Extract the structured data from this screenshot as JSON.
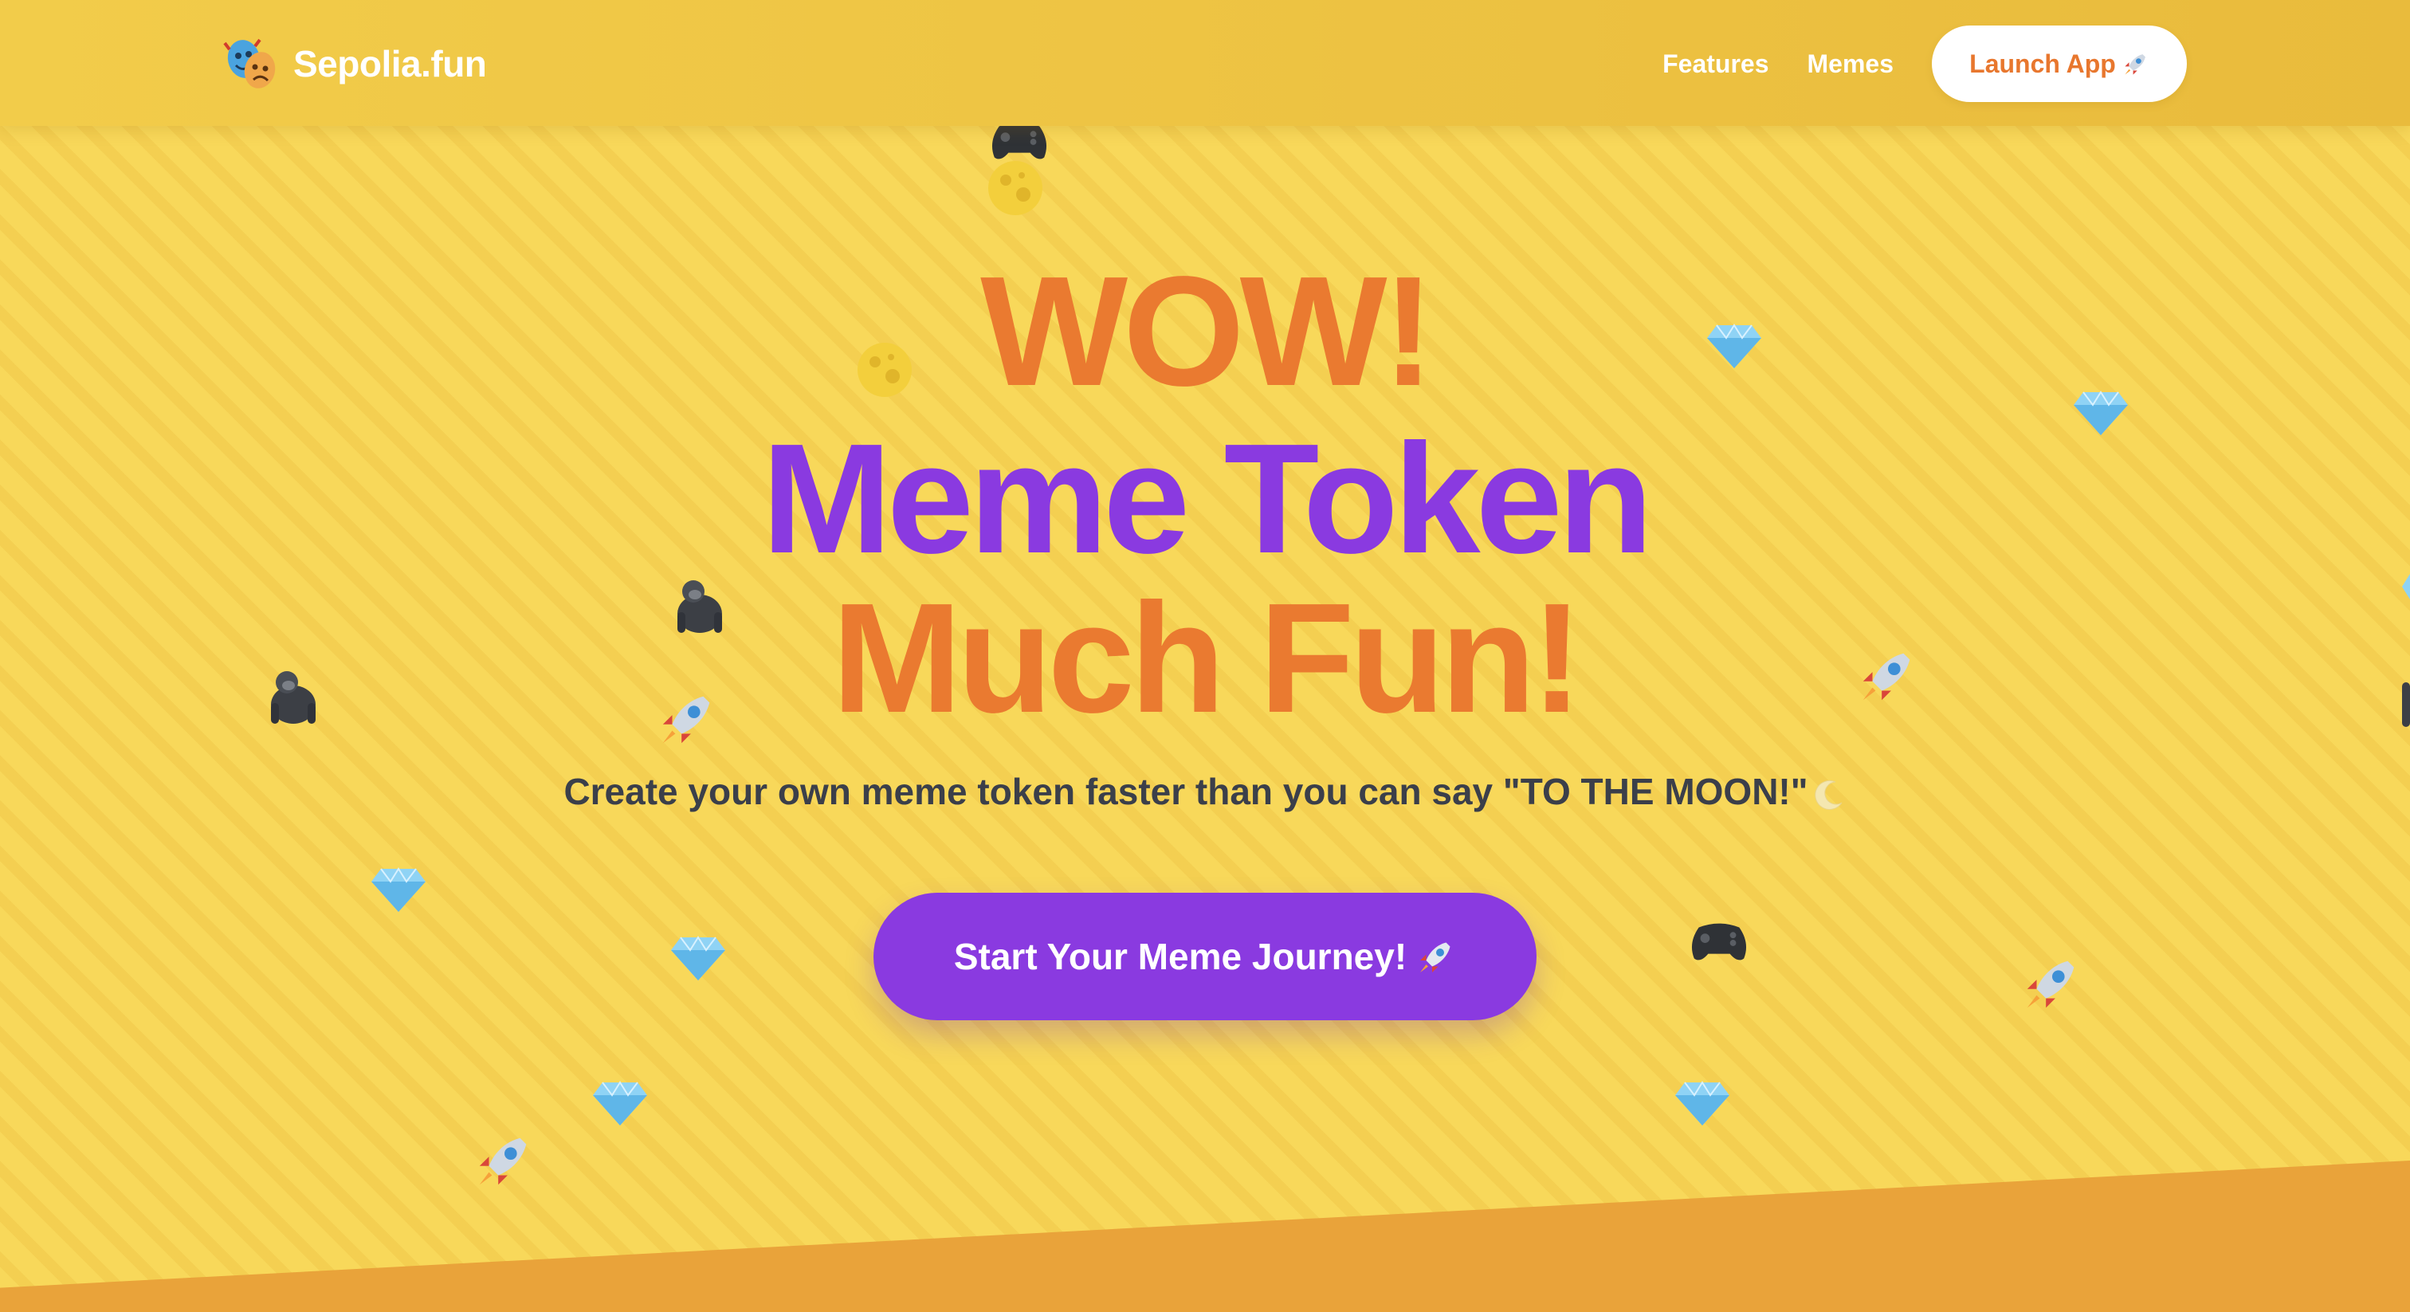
{
  "header": {
    "brand_name": "Sepolia.fun",
    "brand_icon": "performing-arts-masks-icon",
    "nav": [
      {
        "label": "Features"
      },
      {
        "label": "Memes"
      }
    ],
    "launch_button_label": "Launch App"
  },
  "hero": {
    "line1": "WOW!",
    "line2": "Meme Token",
    "line3": "Much Fun!",
    "tagline": "Create your own meme token faster than you can say \"TO THE MOON!\"",
    "cta_label": "Start Your Meme Journey!"
  },
  "colors": {
    "background_yellow": "#f8d85a",
    "accent_orange": "#ea7a30",
    "accent_purple": "#8a3ae0",
    "text_dark": "#3b3f4a",
    "bottom_band": "#e9a33a"
  },
  "floating_icons": [
    "gamepad-icon",
    "moon-icon",
    "moon-icon",
    "diamond-icon",
    "diamond-icon",
    "gorilla-icon",
    "gorilla-icon",
    "rocket-icon",
    "rocket-icon",
    "diamond-icon",
    "diamond-icon",
    "gamepad-icon",
    "rocket-icon",
    "diamond-icon",
    "diamond-icon",
    "rocket-icon"
  ]
}
